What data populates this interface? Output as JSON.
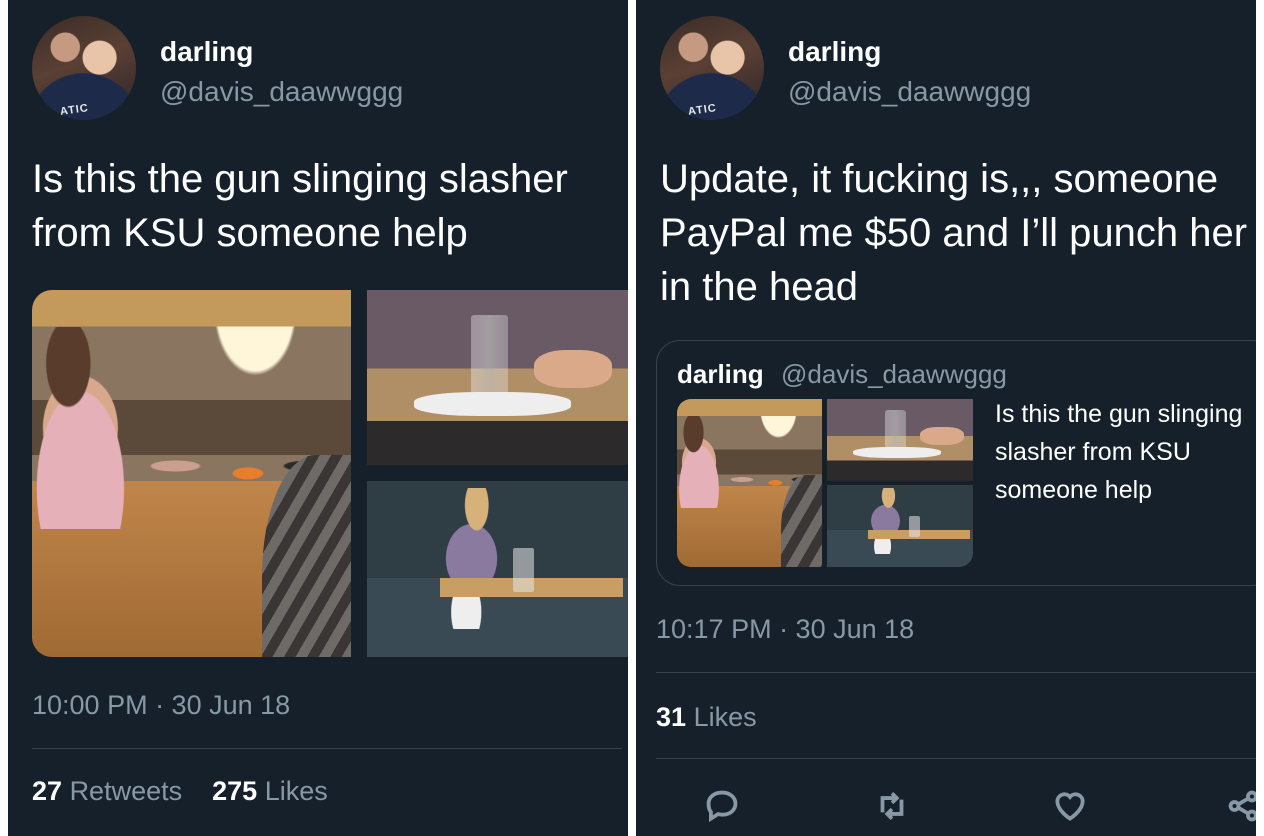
{
  "left_tweet": {
    "display_name": "darling",
    "handle": "@davis_daawwggg",
    "avatar_shirt_text": "ATIC",
    "text": "Is this the gun slinging slasher from KSU someone help",
    "timestamp": "10:00 PM · 30 Jun 18",
    "retweets_count": "27",
    "retweets_label": "Retweets",
    "likes_count": "275",
    "likes_label": "Likes"
  },
  "right_tweet": {
    "display_name": "darling",
    "handle": "@davis_daawwggg",
    "avatar_shirt_text": "ATIC",
    "text": "Update, it fucking is,,, someone PayPal me $50 and I’ll punch her in the head",
    "quoted": {
      "display_name": "darling",
      "handle": "@davis_daawwggg",
      "text": "Is this the gun slinging slasher from KSU someone help"
    },
    "timestamp": "10:17 PM · 30 Jun 18",
    "likes_count": "31",
    "likes_label": "Likes",
    "actions": [
      "reply-icon",
      "retweet-icon",
      "like-icon",
      "share-icon"
    ]
  },
  "colors": {
    "background": "#15202b",
    "text_primary": "#ffffff",
    "text_secondary": "#8899a6",
    "divider": "#38444d"
  }
}
